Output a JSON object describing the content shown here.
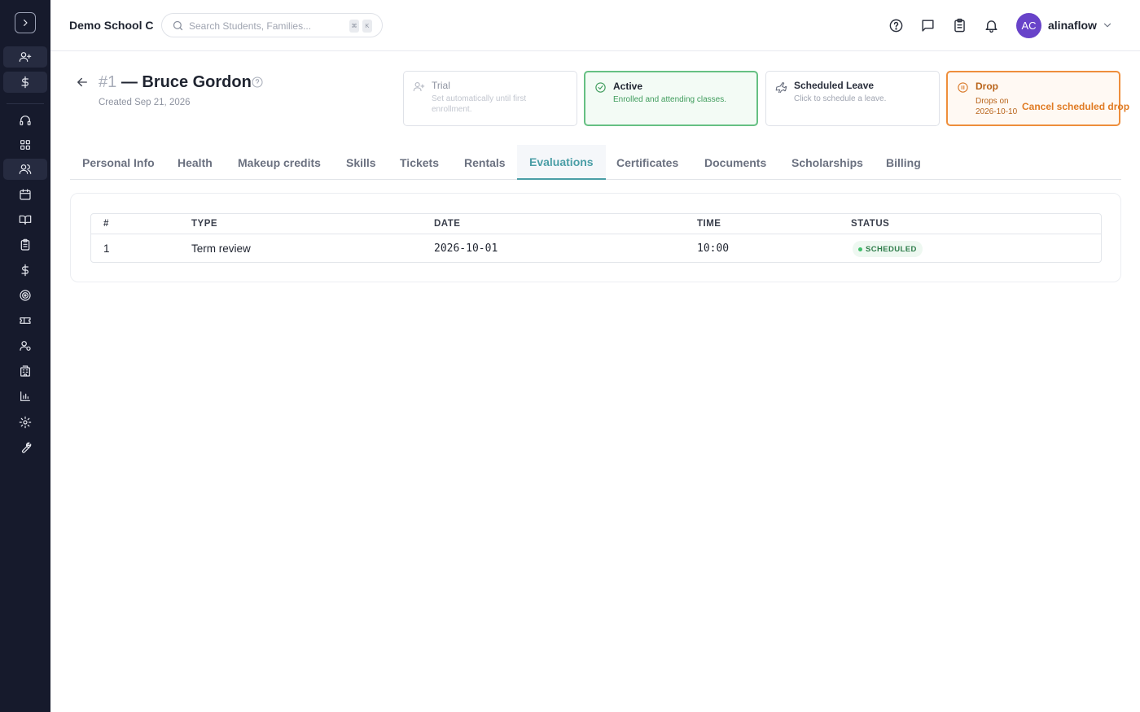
{
  "app": {
    "school_name": "Demo School C",
    "search_placeholder": "Search Students, Families...",
    "shortcut_keys": [
      "⌘",
      "K"
    ],
    "user": {
      "initials": "AC",
      "name": "alinaflow",
      "avatar_color": "#6843c9"
    }
  },
  "sidebar": {
    "items": [
      {
        "name": "add-user-icon",
        "highlight": true
      },
      {
        "name": "dollar-icon",
        "highlight": true
      },
      {
        "name": "headset-icon",
        "highlight": false
      },
      {
        "name": "grid-icon",
        "highlight": false
      },
      {
        "name": "students-icon",
        "highlight": true
      },
      {
        "name": "calendar-icon",
        "highlight": false
      },
      {
        "name": "book-icon",
        "highlight": false
      },
      {
        "name": "clipboard-icon",
        "highlight": false
      },
      {
        "name": "billing-dollar-icon",
        "highlight": false
      },
      {
        "name": "target-icon",
        "highlight": false
      },
      {
        "name": "ticket-icon",
        "highlight": false
      },
      {
        "name": "user-settings-icon",
        "highlight": false
      },
      {
        "name": "building-icon",
        "highlight": false
      },
      {
        "name": "bar-chart-icon",
        "highlight": false
      },
      {
        "name": "gear-icon",
        "highlight": false
      },
      {
        "name": "wrench-icon",
        "highlight": false
      }
    ]
  },
  "student": {
    "number": "#1",
    "separator": "—",
    "name": "Bruce Gordon",
    "created": "Created Sep 21, 2026"
  },
  "status_cards": {
    "trial": {
      "title": "Trial",
      "desc": "Set automatically until first enrollment."
    },
    "active": {
      "title": "Active",
      "desc": "Enrolled and attending classes."
    },
    "leave": {
      "title": "Scheduled Leave",
      "desc": "Click to schedule a leave."
    },
    "drop": {
      "title": "Drop",
      "desc": "Drops on 2026-10-10",
      "action": "Cancel scheduled drop"
    }
  },
  "tabs": [
    "Personal Info",
    "Health",
    "Makeup credits",
    "Skills",
    "Tickets",
    "Rentals",
    "Evaluations",
    "Certificates",
    "Documents",
    "Scholarships",
    "Billing"
  ],
  "active_tab": "Evaluations",
  "evaluations": {
    "columns": [
      "#",
      "TYPE",
      "DATE",
      "TIME",
      "STATUS"
    ],
    "rows": [
      {
        "num": "1",
        "type": "Term review",
        "date": "2026-10-01",
        "time": "10:00",
        "status": "SCHEDULED"
      }
    ]
  },
  "colors": {
    "sidebar_bg": "#161a2c",
    "accent": "#4a9ea6",
    "active_green": "#66c083",
    "drop_orange": "#ee8e3b"
  }
}
